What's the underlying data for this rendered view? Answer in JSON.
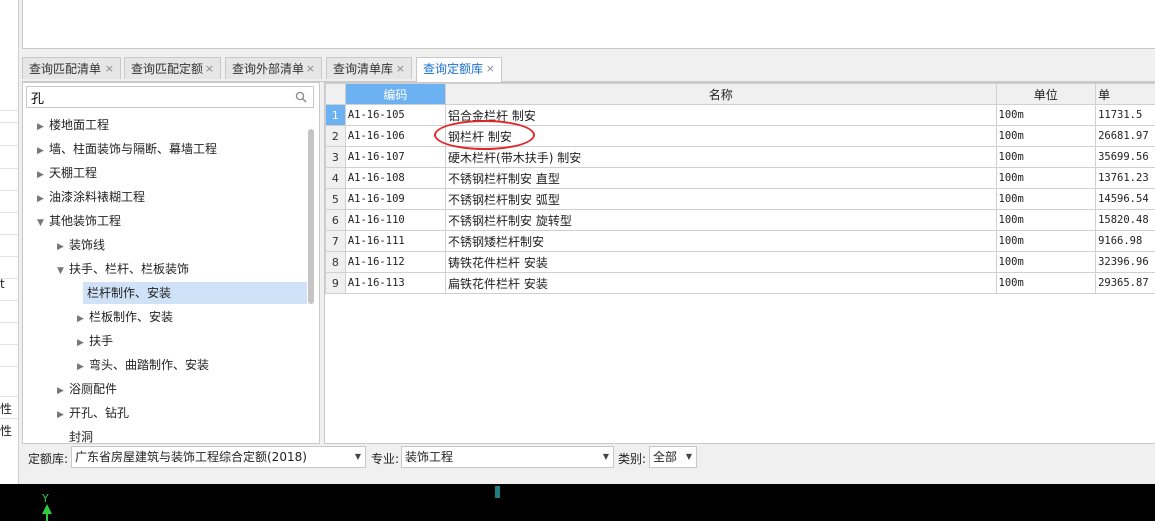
{
  "left_strip": {
    "chars": [
      "t",
      "性",
      "性"
    ]
  },
  "tabs": [
    {
      "label": "查询匹配清单",
      "close": "×",
      "active": false
    },
    {
      "label": "查询匹配定额",
      "close": "×",
      "active": false
    },
    {
      "label": "查询外部清单",
      "close": "×",
      "active": false
    },
    {
      "label": "查询清单库",
      "close": "×",
      "active": false
    },
    {
      "label": "查询定额库",
      "close": "×",
      "active": true
    }
  ],
  "search": {
    "value": "孔",
    "icon": "search-icon"
  },
  "tree": [
    {
      "label": "楼地面工程",
      "expanded": false,
      "level": 0
    },
    {
      "label": "墙、柱面装饰与隔断、幕墙工程",
      "expanded": false,
      "level": 0
    },
    {
      "label": "天棚工程",
      "expanded": false,
      "level": 0
    },
    {
      "label": "油漆涂料裱糊工程",
      "expanded": false,
      "level": 0
    },
    {
      "label": "其他装饰工程",
      "expanded": true,
      "level": 0
    },
    {
      "label": "装饰线",
      "expanded": false,
      "level": 1
    },
    {
      "label": "扶手、栏杆、栏板装饰",
      "expanded": true,
      "level": 1
    },
    {
      "label": "栏杆制作、安装",
      "expanded": null,
      "level": 2,
      "selected": true
    },
    {
      "label": "栏板制作、安装",
      "expanded": false,
      "level": 2
    },
    {
      "label": "扶手",
      "expanded": false,
      "level": 2
    },
    {
      "label": "弯头、曲踏制作、安装",
      "expanded": false,
      "level": 2
    },
    {
      "label": "浴厕配件",
      "expanded": false,
      "level": 1
    },
    {
      "label": "开孔、钻孔",
      "expanded": false,
      "level": 1
    },
    {
      "label": "封洞",
      "expanded": null,
      "level": 1
    }
  ],
  "grid": {
    "headers": [
      "",
      "编码",
      "名称",
      "单位",
      "单"
    ],
    "rows": [
      {
        "no": "1",
        "code": "A1-16-105",
        "name": "铝合金栏杆 制安",
        "unit": "100m",
        "price": "11731.5"
      },
      {
        "no": "2",
        "code": "A1-16-106",
        "name": "钢栏杆 制安",
        "unit": "100m",
        "price": "26681.97"
      },
      {
        "no": "3",
        "code": "A1-16-107",
        "name": "硬木栏杆(带木扶手) 制安",
        "unit": "100m",
        "price": "35699.56"
      },
      {
        "no": "4",
        "code": "A1-16-108",
        "name": "不锈钢栏杆制安 直型",
        "unit": "100m",
        "price": "13761.23"
      },
      {
        "no": "5",
        "code": "A1-16-109",
        "name": "不锈钢栏杆制安 弧型",
        "unit": "100m",
        "price": "14596.54"
      },
      {
        "no": "6",
        "code": "A1-16-110",
        "name": "不锈钢栏杆制安 旋转型",
        "unit": "100m",
        "price": "15820.48"
      },
      {
        "no": "7",
        "code": "A1-16-111",
        "name": "不锈钢矮栏杆制安",
        "unit": "100m",
        "price": "9166.98"
      },
      {
        "no": "8",
        "code": "A1-16-112",
        "name": "铸铁花件栏杆 安装",
        "unit": "100m",
        "price": "32396.96"
      },
      {
        "no": "9",
        "code": "A1-16-113",
        "name": "扁铁花件栏杆 安装",
        "unit": "100m",
        "price": "29365.87"
      }
    ]
  },
  "bottom": {
    "quota_label": "定额库:",
    "quota_value": "广东省房屋建筑与装饰工程综合定额(2018)",
    "major_label": "专业:",
    "major_value": "装饰工程",
    "type_label": "类别:",
    "type_value": "全部"
  },
  "axis": {
    "label": "Y"
  },
  "colors": {
    "accent": "#1a6fd0",
    "selected_header": "#6cb1f2",
    "highlight_circle": "#e0282b"
  }
}
